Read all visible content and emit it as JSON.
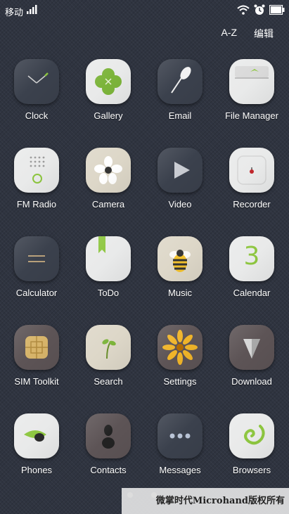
{
  "status": {
    "carrier": "移动",
    "icons": [
      "signal-icon",
      "wifi-icon",
      "alarm-icon",
      "battery-icon"
    ]
  },
  "toolbar": {
    "sort_label": "A-Z",
    "edit_label": "编辑"
  },
  "apps": [
    {
      "label": "Clock",
      "icon": "clock-icon"
    },
    {
      "label": "Gallery",
      "icon": "clover-icon"
    },
    {
      "label": "Email",
      "icon": "feather-icon"
    },
    {
      "label": "File Manager",
      "icon": "tray-icon"
    },
    {
      "label": "FM Radio",
      "icon": "radio-icon"
    },
    {
      "label": "Camera",
      "icon": "flower-icon"
    },
    {
      "label": "Video",
      "icon": "play-icon"
    },
    {
      "label": "Recorder",
      "icon": "mic-icon"
    },
    {
      "label": "Calculator",
      "icon": "calculator-icon"
    },
    {
      "label": "ToDo",
      "icon": "bookmark-icon"
    },
    {
      "label": "Music",
      "icon": "bee-icon"
    },
    {
      "label": "Calendar",
      "icon": "calendar-icon"
    },
    {
      "label": "SIM Toolkit",
      "icon": "sim-chip-icon"
    },
    {
      "label": "Search",
      "icon": "sprout-icon"
    },
    {
      "label": "Settings",
      "icon": "sunflower-icon"
    },
    {
      "label": "Download",
      "icon": "cone-icon"
    },
    {
      "label": "Phones",
      "icon": "leaf-icon"
    },
    {
      "label": "Contacts",
      "icon": "pebbles-icon"
    },
    {
      "label": "Messages",
      "icon": "dots-icon"
    },
    {
      "label": "Browsers",
      "icon": "spiral-icon"
    }
  ],
  "calendar_day": "3",
  "pager": {
    "pages": 2,
    "current": 1
  },
  "watermark": "微掌时代Microhand版权所有"
}
